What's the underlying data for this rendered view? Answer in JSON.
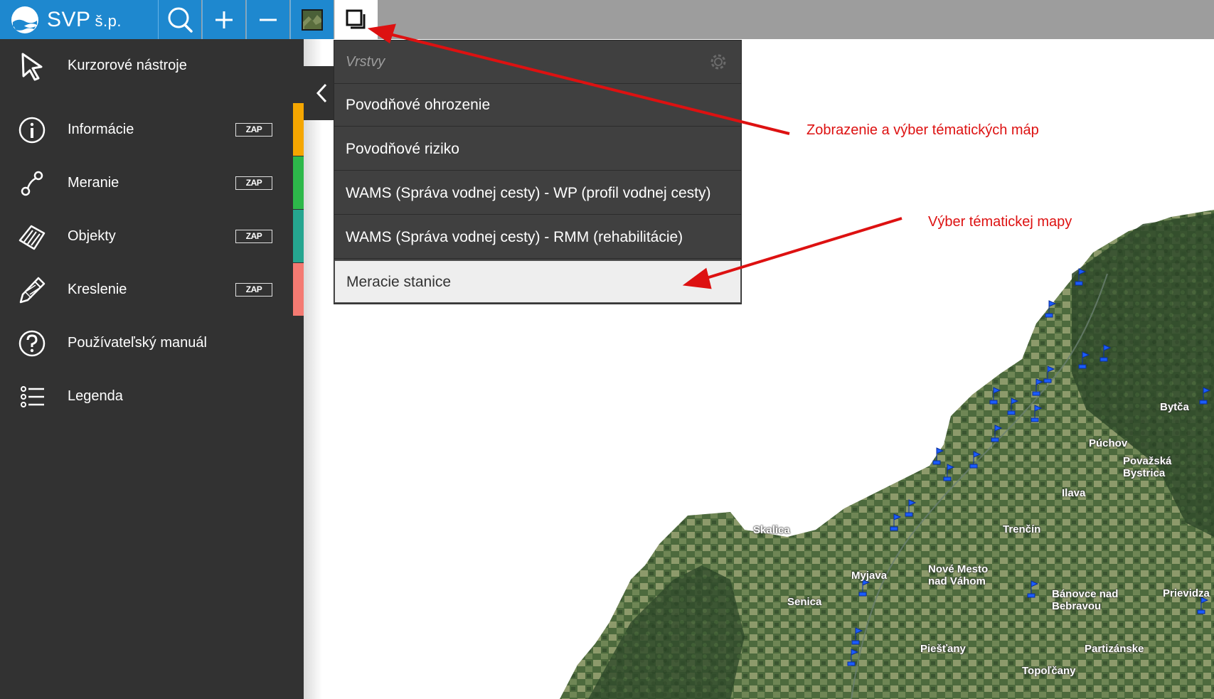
{
  "app": {
    "logo_text": "SVP",
    "logo_suffix": "š.p."
  },
  "toolbar": {
    "search_icon": "search-icon",
    "zoom_in_icon": "plus-icon",
    "zoom_out_icon": "minus-icon",
    "basemap_icon": "satellite-thumbnail-icon",
    "layers_icon": "layers-icon"
  },
  "sidebar": {
    "items": [
      {
        "label": "Kurzorové nástroje",
        "icon": "cursor-icon"
      },
      {
        "label": "Informácie",
        "icon": "info-icon",
        "toggle": "ZAP",
        "color": "#f5a600"
      },
      {
        "label": "Meranie",
        "icon": "measure-icon",
        "toggle": "ZAP",
        "color": "#2db84a"
      },
      {
        "label": "Objekty",
        "icon": "objects-icon",
        "toggle": "ZAP",
        "color": "#25a58f"
      },
      {
        "label": "Kreslenie",
        "icon": "pencil-icon",
        "toggle": "ZAP",
        "color": "#f47a72"
      },
      {
        "label": "Používateľský manuál",
        "icon": "help-icon"
      },
      {
        "label": "Legenda",
        "icon": "legend-list-icon"
      }
    ]
  },
  "layers_dropdown": {
    "title": "Vrstvy",
    "gear_icon": "gear-icon",
    "options": [
      "Povodňové ohrozenie",
      "Povodňové riziko",
      "WAMS (Správa vodnej cesty) - WP (profil vodnej cesty)",
      "WAMS (Správa vodnej cesty) - RMM (rehabilitácie)",
      "Meracie stanice"
    ],
    "selected": "Meracie stanice"
  },
  "annotations": {
    "layers_note": "Zobrazenie a výber tématických máp",
    "selection_note": "Výber tématickej mapy",
    "color": "#dd1111"
  },
  "map": {
    "places": [
      "Skalica",
      "Myjava",
      "Senica",
      "Nové Mesto",
      "nad Váhom",
      "Trenčín",
      "Púchov",
      "Považská",
      "Bystrica",
      "Ilava",
      "Bánovce nad",
      "Bebravou",
      "Prievidza",
      "Piešťany",
      "Partizánske",
      "Topoľčany",
      "Bytča"
    ]
  }
}
